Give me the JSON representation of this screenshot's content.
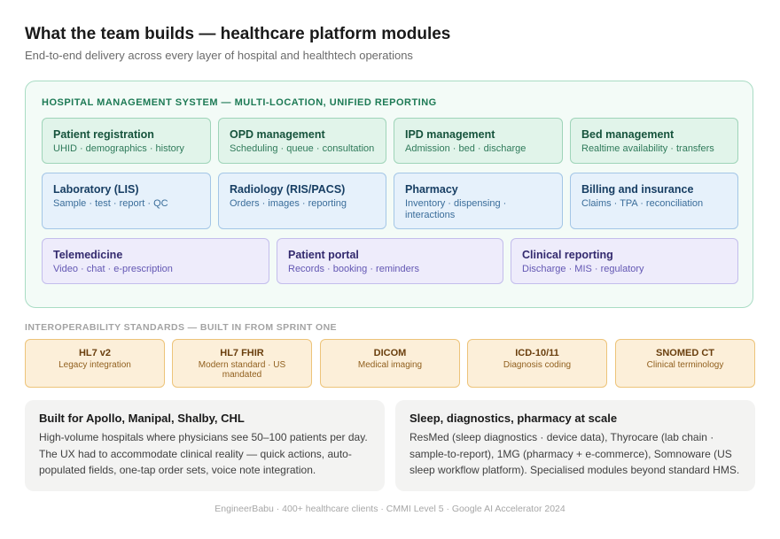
{
  "header": {
    "title": "What the team builds — healthcare platform modules",
    "subtitle": "End-to-end delivery across every layer of hospital and healthtech operations"
  },
  "hms": {
    "heading": "HOSPITAL MANAGEMENT SYSTEM — MULTI-LOCATION, UNIFIED REPORTING",
    "modules": [
      {
        "name": "Patient registration",
        "desc": "UHID · demographics · history"
      },
      {
        "name": "OPD management",
        "desc": "Scheduling · queue · consultation"
      },
      {
        "name": "IPD management",
        "desc": "Admission · bed · discharge"
      },
      {
        "name": "Bed management",
        "desc": "Realtime availability · transfers"
      },
      {
        "name": "Laboratory (LIS)",
        "desc": "Sample · test · report · QC"
      },
      {
        "name": "Radiology (RIS/PACS)",
        "desc": "Orders · images · reporting"
      },
      {
        "name": "Pharmacy",
        "desc": "Inventory · dispensing · interactions"
      },
      {
        "name": "Billing and insurance",
        "desc": "Claims · TPA · reconciliation"
      },
      {
        "name": "Telemedicine",
        "desc": "Video · chat · e-prescription"
      },
      {
        "name": "Patient portal",
        "desc": "Records · booking · reminders"
      },
      {
        "name": "Clinical reporting",
        "desc": "Discharge · MIS · regulatory"
      }
    ]
  },
  "interop": {
    "heading": "INTEROPERABILITY STANDARDS — BUILT IN FROM SPRINT ONE",
    "standards": [
      {
        "name": "HL7 v2",
        "desc": "Legacy integration"
      },
      {
        "name": "HL7 FHIR",
        "desc": "Modern standard · US mandated"
      },
      {
        "name": "DICOM",
        "desc": "Medical imaging"
      },
      {
        "name": "ICD-10/11",
        "desc": "Diagnosis coding"
      },
      {
        "name": "SNOMED CT",
        "desc": "Clinical terminology"
      }
    ]
  },
  "cards": [
    {
      "title": "Built for Apollo, Manipal, Shalby, CHL",
      "body": "High-volume hospitals where physicians see 50–100 patients per day. The UX had to accommodate clinical reality — quick actions, auto-populated fields, one-tap order sets, voice note integration."
    },
    {
      "title": "Sleep, diagnostics, pharmacy at scale",
      "body": "ResMed (sleep diagnostics · device data), Thyrocare (lab chain · sample-to-report), 1MG (pharmacy + e-commerce), Somnoware (US sleep workflow platform). Specialised modules beyond standard HMS."
    }
  ],
  "footer": "EngineerBabu · 400+ healthcare clients · CMMI Level 5 · Google AI Accelerator 2024",
  "colors": {
    "green_tile": "#e1f4ea",
    "blue_tile": "#e6f1fb",
    "purple_tile": "#eeecfb",
    "amber_tile": "#fcefd9",
    "hms_heading": "#1d7a55"
  }
}
